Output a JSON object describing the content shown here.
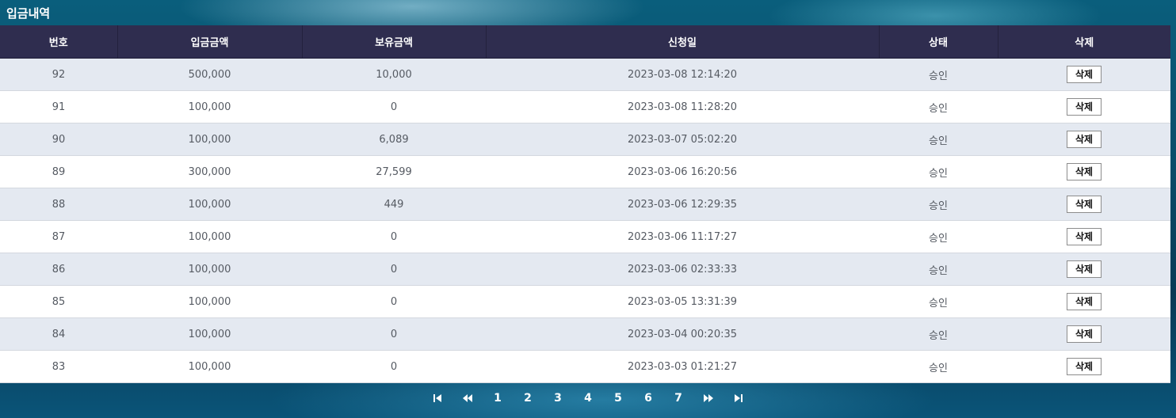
{
  "header": {
    "title": "입금내역"
  },
  "table": {
    "columns": [
      "번호",
      "입금금액",
      "보유금액",
      "신청일",
      "상태",
      "삭제"
    ],
    "delete_label": "삭제",
    "rows": [
      {
        "no": "92",
        "deposit": "500,000",
        "balance": "10,000",
        "date": "2023-03-08 12:14:20",
        "status": "승인"
      },
      {
        "no": "91",
        "deposit": "100,000",
        "balance": "0",
        "date": "2023-03-08 11:28:20",
        "status": "승인"
      },
      {
        "no": "90",
        "deposit": "100,000",
        "balance": "6,089",
        "date": "2023-03-07 05:02:20",
        "status": "승인"
      },
      {
        "no": "89",
        "deposit": "300,000",
        "balance": "27,599",
        "date": "2023-03-06 16:20:56",
        "status": "승인"
      },
      {
        "no": "88",
        "deposit": "100,000",
        "balance": "449",
        "date": "2023-03-06 12:29:35",
        "status": "승인"
      },
      {
        "no": "87",
        "deposit": "100,000",
        "balance": "0",
        "date": "2023-03-06 11:17:27",
        "status": "승인"
      },
      {
        "no": "86",
        "deposit": "100,000",
        "balance": "0",
        "date": "2023-03-06 02:33:33",
        "status": "승인"
      },
      {
        "no": "85",
        "deposit": "100,000",
        "balance": "0",
        "date": "2023-03-05 13:31:39",
        "status": "승인"
      },
      {
        "no": "84",
        "deposit": "100,000",
        "balance": "0",
        "date": "2023-03-04 00:20:35",
        "status": "승인"
      },
      {
        "no": "83",
        "deposit": "100,000",
        "balance": "0",
        "date": "2023-03-03 01:21:27",
        "status": "승인"
      }
    ]
  },
  "pagination": {
    "first_icon": "skip-first-icon",
    "prev_icon": "rewind-icon",
    "next_icon": "fast-forward-icon",
    "last_icon": "skip-last-icon",
    "pages": [
      "1",
      "2",
      "3",
      "4",
      "5",
      "6",
      "7"
    ]
  },
  "colors": {
    "header_bg": "#2f2d4f",
    "row_odd": "#e4e9f1",
    "row_even": "#ffffff",
    "page_bg": "#0b4d69"
  }
}
